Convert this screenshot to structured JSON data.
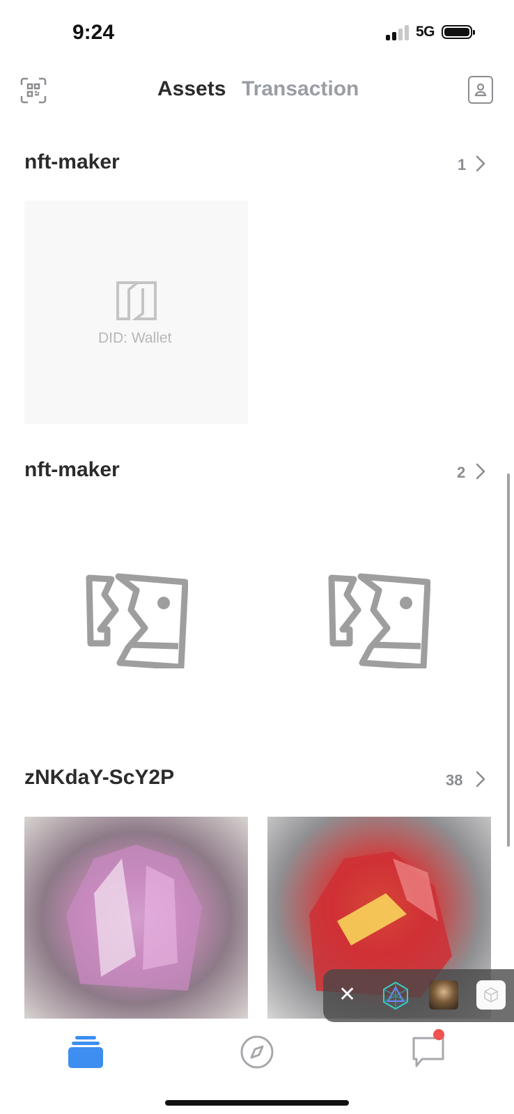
{
  "status_bar": {
    "time": "9:24",
    "network": "5G"
  },
  "header": {
    "tab_assets": "Assets",
    "tab_transaction": "Transaction"
  },
  "sections": [
    {
      "title": "nft-maker",
      "count": "1"
    },
    {
      "title": "nft-maker",
      "count": "2"
    },
    {
      "title": "zNKdaY-ScY2P",
      "count": "38"
    }
  ],
  "placeholder": {
    "logo_text": "DID: Wallet"
  },
  "colors": {
    "accent": "#3d8ef0",
    "badge": "#ef5350",
    "muted": "#9a9da3"
  },
  "icons": [
    "qr-scan-icon",
    "profile-icon",
    "chevron-right-icon",
    "broken-image-icon",
    "wallet-icon",
    "compass-icon",
    "chat-icon",
    "close-icon",
    "hexagon-icon",
    "box-icon"
  ]
}
